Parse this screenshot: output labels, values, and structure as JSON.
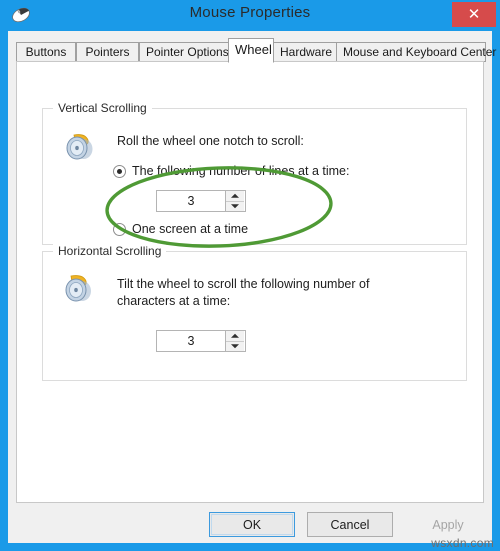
{
  "window": {
    "title": "Mouse Properties",
    "icon": "mouse-icon",
    "close_label": "✕",
    "accent_color": "#1a9ae8",
    "close_color": "#d64b4b"
  },
  "tabs": [
    {
      "label": "Buttons",
      "selected": false
    },
    {
      "label": "Pointers",
      "selected": false
    },
    {
      "label": "Pointer Options",
      "selected": false
    },
    {
      "label": "Wheel",
      "selected": true
    },
    {
      "label": "Hardware",
      "selected": false
    },
    {
      "label": "Mouse and Keyboard Center",
      "selected": false
    }
  ],
  "vertical_scrolling": {
    "group_label": "Vertical Scrolling",
    "icon": "mouse-wheel-vertical-icon",
    "description": "Roll the wheel one notch to scroll:",
    "option_lines": {
      "label": "The following number of lines at a time:",
      "checked": true
    },
    "lines_value": "3",
    "option_screen": {
      "label": "One screen at a time",
      "checked": false
    }
  },
  "horizontal_scrolling": {
    "group_label": "Horizontal Scrolling",
    "icon": "mouse-wheel-horizontal-icon",
    "description_line1": "Tilt the wheel to scroll the following number of",
    "description_line2": "characters at a time:",
    "characters_value": "3"
  },
  "annotation": {
    "shape": "ellipse-highlight",
    "color": "#4f9a35",
    "target": "The following number of lines at a time"
  },
  "buttons": {
    "ok": "OK",
    "cancel": "Cancel",
    "apply": "Apply"
  },
  "watermark": "wsxdn.com"
}
